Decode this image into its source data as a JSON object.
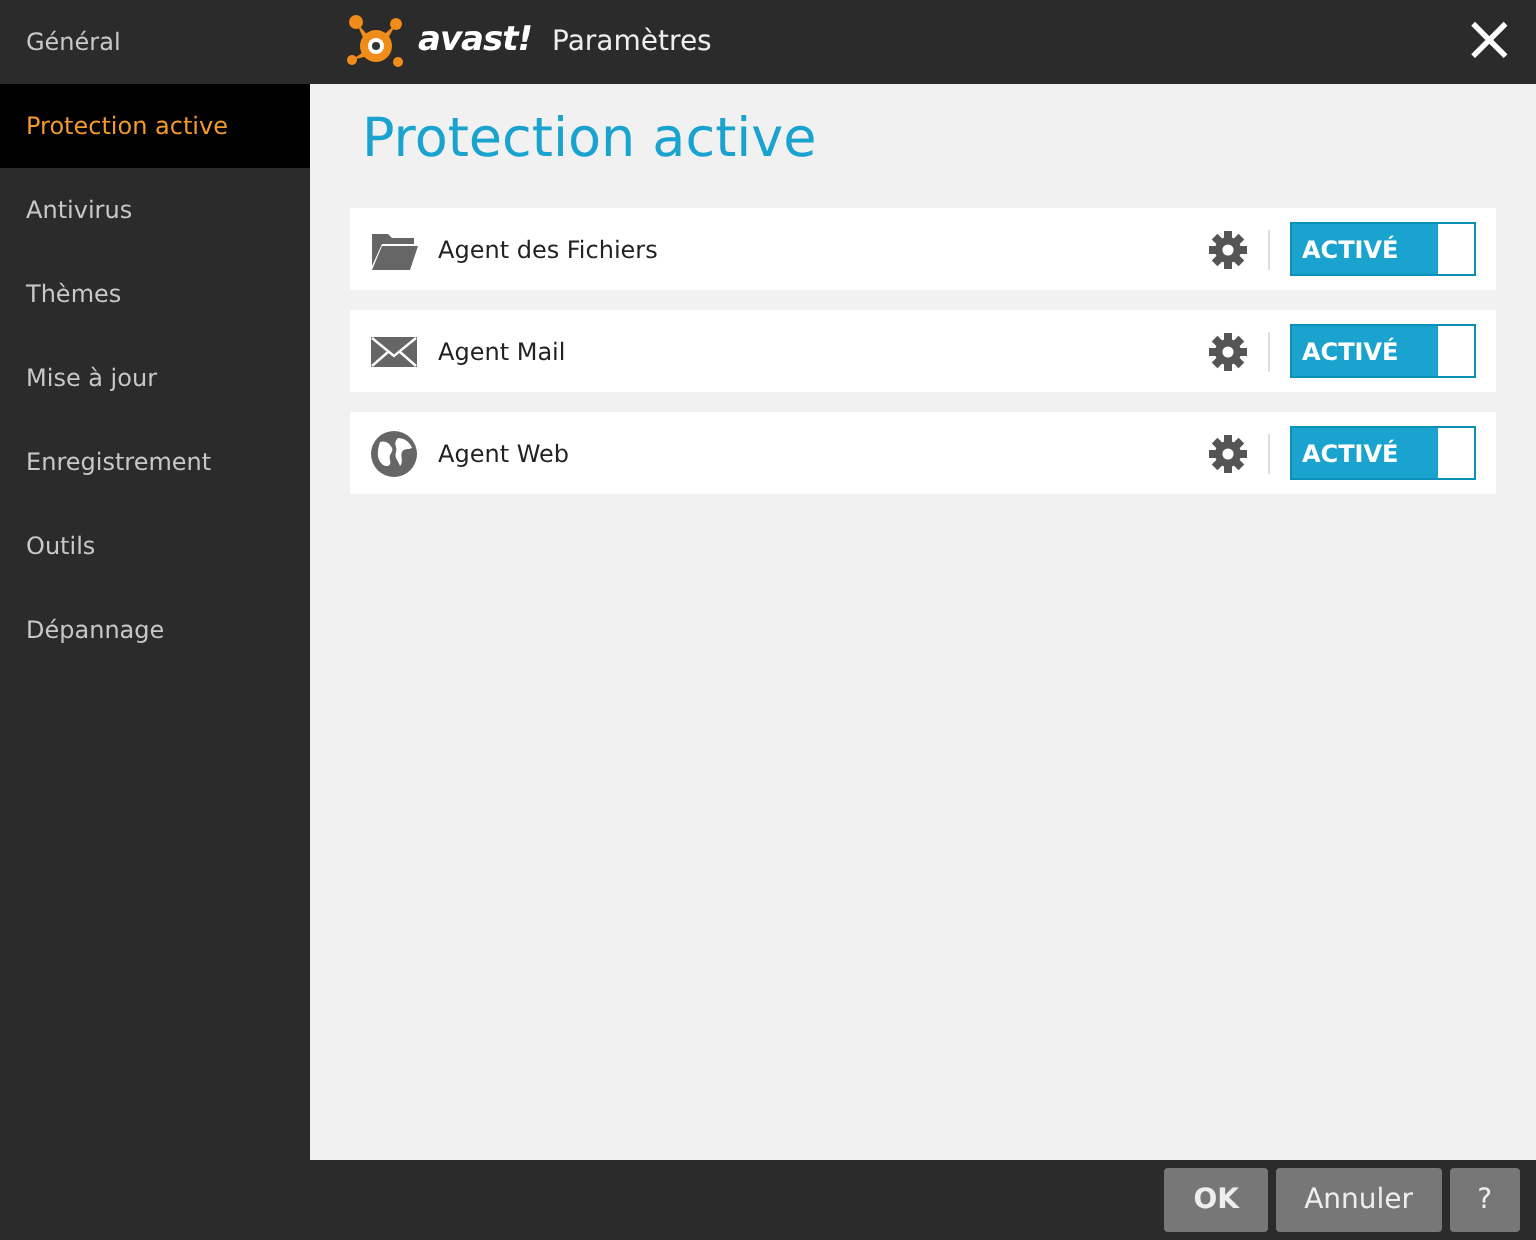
{
  "sidebar": {
    "items": [
      {
        "label": "Général",
        "selected": false
      },
      {
        "label": "Protection active",
        "selected": true
      },
      {
        "label": "Antivirus",
        "selected": false
      },
      {
        "label": "Thèmes",
        "selected": false
      },
      {
        "label": "Mise à jour",
        "selected": false
      },
      {
        "label": "Enregistrement",
        "selected": false
      },
      {
        "label": "Outils",
        "selected": false
      },
      {
        "label": "Dépannage",
        "selected": false
      }
    ]
  },
  "window": {
    "logo": "avast!",
    "title": "Paramètres",
    "close": "×"
  },
  "page_title": "Protection active",
  "agents": [
    {
      "kind": "folder",
      "name": "Agent des Fichiers",
      "on": true,
      "toggle": "ACTIVÉ"
    },
    {
      "kind": "mail",
      "name": "Agent Mail",
      "on": true,
      "toggle": "ACTIVÉ"
    },
    {
      "kind": "globe",
      "name": "Agent Web",
      "on": true,
      "toggle": "ACTIVÉ"
    }
  ],
  "buttons": [
    {
      "kind": "primary",
      "label": "OK"
    },
    {
      "kind": "normal",
      "label": "Annuler"
    },
    {
      "kind": "normal",
      "label": "?"
    }
  ]
}
